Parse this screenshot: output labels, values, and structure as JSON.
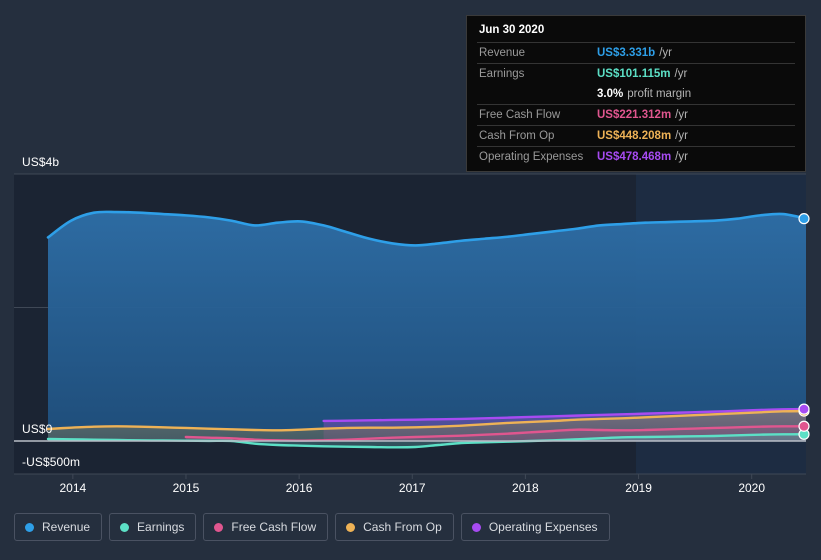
{
  "chart_data": {
    "type": "area",
    "title": "",
    "xlabel": "",
    "ylabel": "",
    "ylim": [
      -500,
      4000
    ],
    "yunit": "US$ millions",
    "grid": true,
    "legend_position": "bottom",
    "y_ticks": [
      {
        "label": "US$4b",
        "value": 4000
      },
      {
        "label": "US$0",
        "value": 0
      },
      {
        "label": "-US$500m",
        "value": -500
      }
    ],
    "x_ticks": [
      "2014",
      "2015",
      "2016",
      "2017",
      "2018",
      "2019",
      "2020"
    ],
    "forecast_start": "2019.6",
    "series": [
      {
        "name": "Revenue",
        "color": "#2e9fe8",
        "values": [
          3050,
          3300,
          3420,
          3430,
          3420,
          3400,
          3380,
          3350,
          3300,
          3230,
          3270,
          3290,
          3230,
          3130,
          3030,
          2960,
          2930,
          2960,
          3000,
          3030,
          3060,
          3100,
          3140,
          3180,
          3230,
          3250,
          3270,
          3280,
          3290,
          3300,
          3330,
          3380,
          3400,
          3331
        ]
      },
      {
        "name": "Earnings",
        "color": "#5ce0c6",
        "values": [
          30,
          25,
          20,
          15,
          10,
          8,
          5,
          2,
          0,
          -40,
          -60,
          -70,
          -80,
          -85,
          -90,
          -95,
          -90,
          -60,
          -30,
          -20,
          -10,
          0,
          10,
          25,
          40,
          55,
          60,
          65,
          70,
          75,
          85,
          95,
          100,
          101
        ]
      },
      {
        "name": "Free Cash Flow",
        "color": "#e0568f",
        "values": [
          null,
          null,
          null,
          null,
          null,
          null,
          60,
          50,
          40,
          20,
          10,
          5,
          10,
          20,
          35,
          50,
          60,
          70,
          80,
          95,
          110,
          130,
          150,
          170,
          165,
          160,
          165,
          175,
          185,
          195,
          205,
          215,
          220,
          221
        ]
      },
      {
        "name": "Cash From Op",
        "color": "#eeb256",
        "values": [
          180,
          200,
          215,
          220,
          215,
          205,
          195,
          185,
          175,
          165,
          160,
          170,
          185,
          195,
          200,
          200,
          205,
          215,
          230,
          250,
          270,
          285,
          300,
          320,
          330,
          340,
          355,
          370,
          385,
          400,
          415,
          430,
          445,
          448
        ]
      },
      {
        "name": "Operating Expenses",
        "color": "#a74bf2",
        "values": [
          null,
          null,
          null,
          null,
          null,
          null,
          null,
          null,
          null,
          null,
          null,
          null,
          300,
          305,
          310,
          315,
          320,
          325,
          330,
          340,
          350,
          360,
          370,
          380,
          390,
          400,
          410,
          420,
          430,
          440,
          452,
          465,
          474,
          478
        ]
      }
    ]
  },
  "tooltip": {
    "date": "Jun 30 2020",
    "rows": [
      {
        "key": "Revenue",
        "value": "US$3.331b",
        "unit": "/yr",
        "color": "#2e9fe8"
      },
      {
        "key": "Earnings",
        "value": "US$101.115m",
        "unit": "/yr",
        "color": "#5ce0c6"
      },
      {
        "key": "",
        "value": "3.0%",
        "unit": "profit margin",
        "color": "#ffffff"
      },
      {
        "key": "Free Cash Flow",
        "value": "US$221.312m",
        "unit": "/yr",
        "color": "#e0568f"
      },
      {
        "key": "Cash From Op",
        "value": "US$448.208m",
        "unit": "/yr",
        "color": "#eeb256"
      },
      {
        "key": "Operating Expenses",
        "value": "US$478.468m",
        "unit": "/yr",
        "color": "#a74bf2"
      }
    ]
  },
  "legend": {
    "items": [
      {
        "label": "Revenue",
        "color": "#2e9fe8"
      },
      {
        "label": "Earnings",
        "color": "#5ce0c6"
      },
      {
        "label": "Free Cash Flow",
        "color": "#e0568f"
      },
      {
        "label": "Cash From Op",
        "color": "#eeb256"
      },
      {
        "label": "Operating Expenses",
        "color": "#a74bf2"
      }
    ]
  },
  "colors": {
    "background": "#252f3e",
    "plot_background": "#1b2433",
    "forecast_background": "#1d2c42",
    "gridline": "#3f4856",
    "zeroline": "#b9bec7"
  }
}
